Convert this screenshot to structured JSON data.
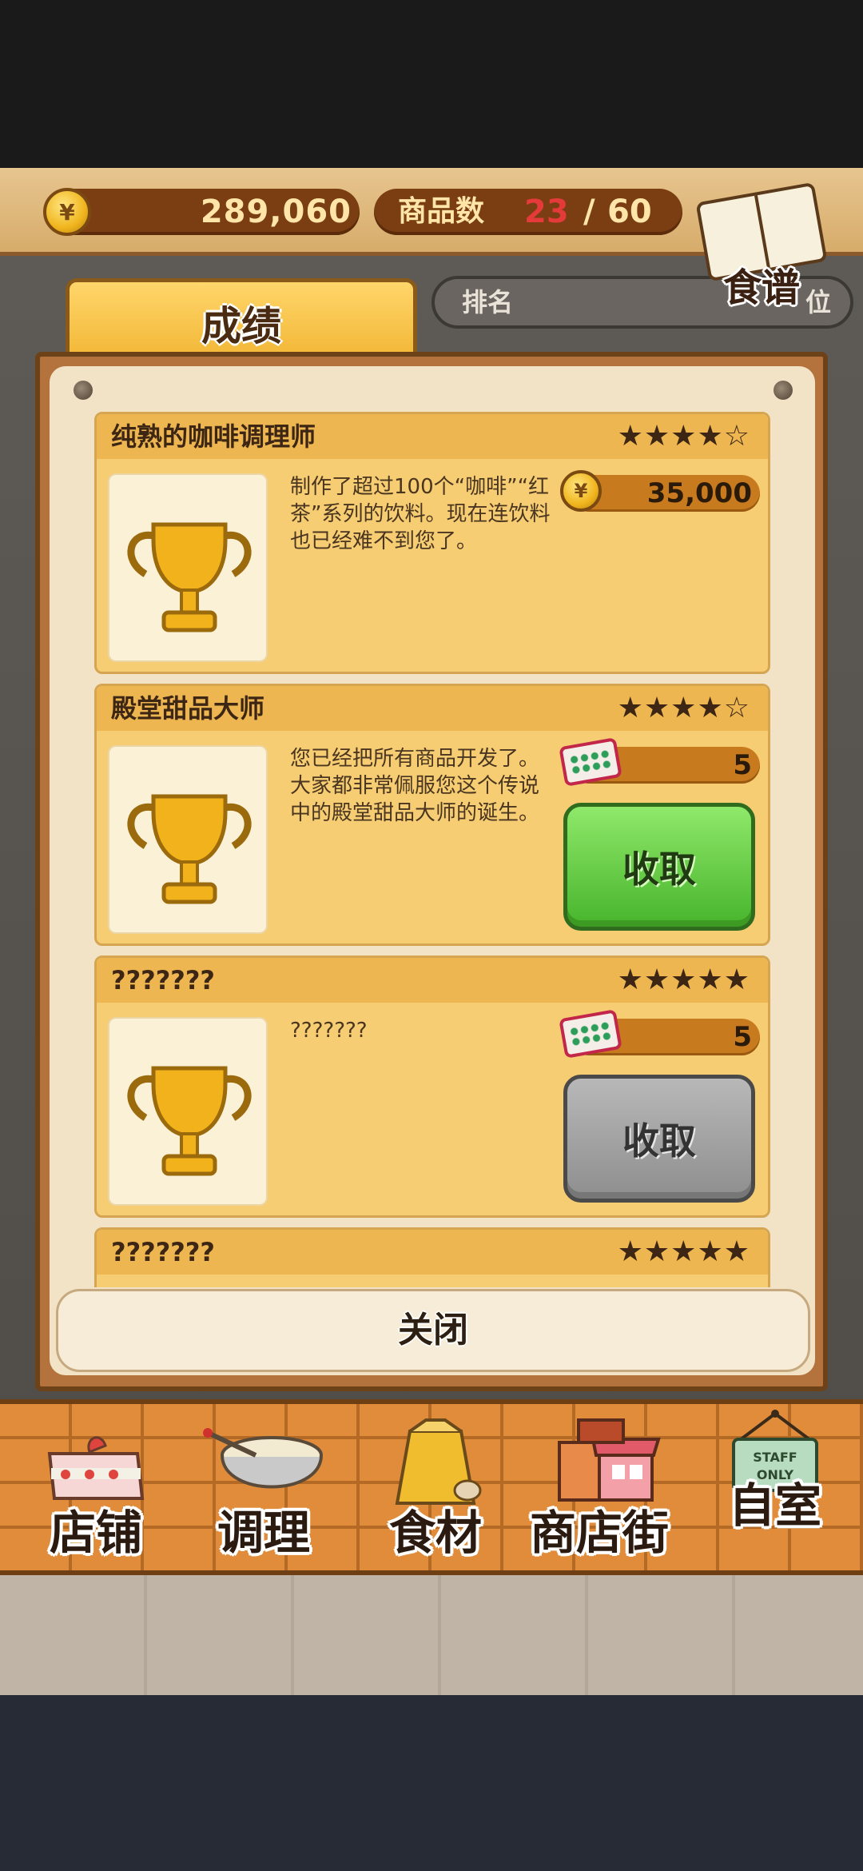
{
  "header": {
    "money": "289,060",
    "coin_symbol": "¥",
    "goods_label": "商品数",
    "goods_count": "23",
    "goods_separator": "/",
    "goods_max": "60",
    "recipe_label": "食谱"
  },
  "rank": {
    "label": "排名",
    "suffix": "位"
  },
  "tab": {
    "label": "成绩"
  },
  "achievements": [
    {
      "title": "纯熟的咖啡调理师",
      "stars": "★★★★☆",
      "description": "制作了超过100个“咖啡”“红茶”系列的饮料。现在连饮料也已经难不到您了。",
      "reward_type": "coin",
      "reward_value": "35,000"
    },
    {
      "title": "殿堂甜品大师",
      "stars": "★★★★☆",
      "description": "您已经把所有商品开发了。大家都非常佩服您这个传说中的殿堂甜品大师的诞生。",
      "reward_type": "ticket",
      "reward_value": "5",
      "button": "收取",
      "button_state": "active"
    },
    {
      "title": "???????",
      "stars": "★★★★★",
      "description": "???????",
      "reward_type": "ticket",
      "reward_value": "5",
      "button": "收取",
      "button_state": "disabled"
    },
    {
      "title": "???????",
      "stars": "★★★★★"
    }
  ],
  "close_label": "关闭",
  "nav": [
    {
      "label": "店铺",
      "icon": "cake-icon"
    },
    {
      "label": "调理",
      "icon": "mixing-bowl-icon"
    },
    {
      "label": "食材",
      "icon": "ingredient-sack-icon"
    },
    {
      "label": "商店街",
      "icon": "shop-street-icon"
    },
    {
      "label": "自室",
      "icon": "staff-only-sign-icon"
    }
  ],
  "nav_sign_text": "STAFF ONLY",
  "colors": {
    "claim_active": "#47b42c",
    "claim_disabled": "#8e8e8e",
    "goods_count": "#e53a3a"
  }
}
